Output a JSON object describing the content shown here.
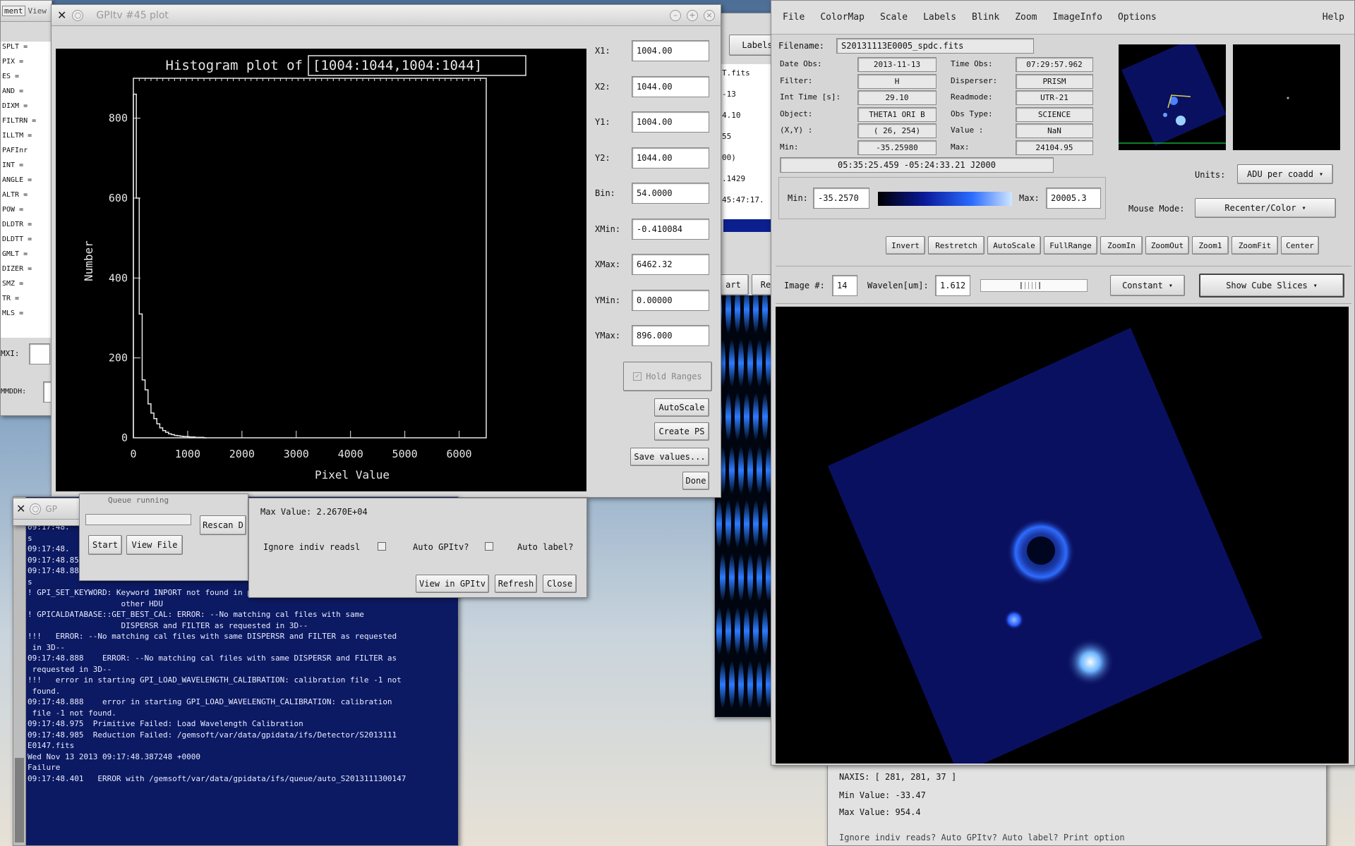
{
  "left_window": {
    "menu": "ment",
    "title_fragment": "View",
    "rows": [
      "SPLT =",
      "PIX =",
      "ES =",
      "AND =",
      "DIXM =",
      "FILTRN =",
      "ILLTM =",
      "PAFInr",
      "INT =",
      "ANGLE =",
      "ALTR =",
      "POW =",
      "DLDTR =",
      "DLDTT =",
      "GMLT =",
      "DIZER =",
      "SMZ =",
      "TR =",
      "MLS ="
    ],
    "field_labels": [
      "MXI:",
      "MMDDH:"
    ]
  },
  "histogram_window": {
    "title": "GPItv #45 plot",
    "plot_title": "Histogram plot of",
    "region": "[1004:1044,1004:1044]",
    "ranges": [
      {
        "label": "X1:",
        "value": "1004.00"
      },
      {
        "label": "X2:",
        "value": "1044.00"
      },
      {
        "label": "Y1:",
        "value": "1004.00"
      },
      {
        "label": "Y2:",
        "value": "1044.00"
      },
      {
        "label": "Bin:",
        "value": "54.0000"
      },
      {
        "label": "XMin:",
        "value": "-0.410084"
      },
      {
        "label": "XMax:",
        "value": "6462.32"
      },
      {
        "label": "YMin:",
        "value": "0.00000"
      },
      {
        "label": "YMax:",
        "value": "896.000"
      }
    ],
    "hold_ranges": "Hold Ranges",
    "buttons": {
      "autoscale": "AutoScale",
      "create_ps": "Create PS",
      "save_values": "Save values...",
      "done": "Done"
    }
  },
  "chart_data": {
    "type": "bar",
    "title": "Histogram plot of [1004:1044,1004:1044]",
    "xlabel": "Pixel Value",
    "ylabel": "Number",
    "xlim": [
      0,
      6500
    ],
    "ylim": [
      0,
      900
    ],
    "xticks": [
      0,
      1000,
      2000,
      3000,
      4000,
      5000,
      6000
    ],
    "yticks": [
      0,
      200,
      400,
      600,
      800
    ],
    "x": [
      27,
      81,
      135,
      189,
      243,
      297,
      351,
      405,
      459,
      513,
      567,
      621,
      675,
      729,
      783,
      837,
      891,
      945,
      999,
      1053,
      1107,
      1161,
      1215,
      1269,
      1323
    ],
    "values": [
      860,
      600,
      310,
      145,
      120,
      85,
      62,
      48,
      35,
      25,
      18,
      14,
      10,
      8,
      6,
      5,
      4,
      3,
      3,
      2,
      2,
      1,
      1,
      1,
      0
    ]
  },
  "recipe_window": {
    "title": "GP",
    "buttons": {
      "start": "Start",
      "view_file": "View File",
      "rescan": "Rescan D"
    },
    "top_text": "Queue running"
  },
  "stats_panel": {
    "max_value": "Max Value: 2.2670E+04",
    "ignore_label": "Ignore indiv readsl",
    "auto_gpitv": "Auto GPItv?",
    "auto_label": "Auto label?",
    "buttons": {
      "view": "View in GPItv",
      "refresh": "Refresh",
      "close": "Close"
    }
  },
  "console": {
    "lines": [
      "09:17:48.",
      "09:17:48.",
      "09:17:48.",
      "s",
      "09:17:48.",
      "09:17:48.857         Primitive complete",
      "09:17:48.880         Running primitive",
      "s",
      "! GPI_SET_KEYWORD: Keyword INPORT not found in preferred header; trying the",
      "                    other HDU",
      "! GPICALDATABASE::GET_BEST_CAL: ERROR: --No matching cal files with same",
      "                    DISPERSR and FILTER as requested in 3D--",
      "!!!   ERROR: --No matching cal files with same DISPERSR and FILTER as requested",
      " in 3D--",
      "09:17:48.888    ERROR: --No matching cal files with same DISPERSR and FILTER as",
      " requested in 3D--",
      "!!!   error in starting GPI_LOAD_WAVELENGTH_CALIBRATION: calibration file -1 not",
      " found.",
      "09:17:48.888    error in starting GPI_LOAD_WAVELENGTH_CALIBRATION: calibration",
      " file -1 not found.",
      "09:17:48.975  Primitive Failed: Load Wavelength Calibration",
      "09:17:48.985  Reduction Failed: /gemsoft/var/data/gpidata/ifs/Detector/S2013111",
      "E0147.fits",
      "",
      "Wed Nov 13 2013 09:17:48.387248 +0000",
      "",
      "Failure",
      "09:17:48.401   ERROR with /gemsoft/var/data/gpidata/ifs/queue/auto_S2013111300147"
    ]
  },
  "bg_window": {
    "rows": [
      "T.fits",
      "-13",
      "4.10",
      "55",
      "00)",
      ".1429",
      "45:47:17."
    ],
    "labels": "Labels",
    "buttons": [
      "art",
      "Re"
    ]
  },
  "gpitv": {
    "menu": [
      "File",
      "ColorMap",
      "Scale",
      "Labels",
      "Blink",
      "Zoom",
      "ImageInfo",
      "Options"
    ],
    "help": "Help",
    "filename_label": "Filename:",
    "filename": "S20131113E0005_spdc.fits",
    "info": [
      {
        "l1": "Date Obs:",
        "v1": "2013-11-13",
        "l2": "Time Obs:",
        "v2": "07:29:57.962"
      },
      {
        "l1": "Filter:",
        "v1": "H",
        "l2": "Disperser:",
        "v2": "PRISM"
      },
      {
        "l1": "Int Time [s]:",
        "v1": "29.10",
        "l2": "Readmode:",
        "v2": "UTR-21"
      },
      {
        "l1": "Object:",
        "v1": "THETA1 ORI B",
        "l2": "Obs Type:",
        "v2": "SCIENCE"
      },
      {
        "l1": "(X,Y) :",
        "v1": "( 26, 254)",
        "l2": "Value :",
        "v2": "NaN"
      },
      {
        "l1": "Min:",
        "v1": "-35.25980",
        "l2": "Max:",
        "v2": "24104.95"
      }
    ],
    "coords": "05:35:25.459   -05:24:33.21   J2000",
    "min_label": "Min:",
    "min_value": "-35.2570",
    "max_label": "Max:",
    "max_value": "20005.3",
    "units_label": "Units:",
    "units_value": "ADU per coadd",
    "mouse_label": "Mouse Mode:",
    "mouse_value": "Recenter/Color",
    "buttons": [
      "Invert",
      "Restretch",
      "AutoScale",
      "FullRange",
      "ZoomIn",
      "ZoomOut",
      "Zoom1",
      "ZoomFit",
      "Center"
    ],
    "image_label": "Image #:",
    "image_value": "14",
    "wavelen_label": "Wavelen[um]:",
    "wavelen_value": "1.612",
    "collapse_value": "Constant",
    "cube_value": "Show Cube Slices",
    "colors": {
      "accent": "#1a3cff",
      "image_bg": "#0a1060",
      "frame": "#000000"
    }
  },
  "stats_bottom": {
    "nax": "NAXIS: [ 281, 281, 37 ]",
    "min": "Min Value:      -33.47",
    "max": "Max Value:      954.4",
    "footer": "Ignore indiv reads?      Auto GPItv?      Auto label?      Print option"
  }
}
